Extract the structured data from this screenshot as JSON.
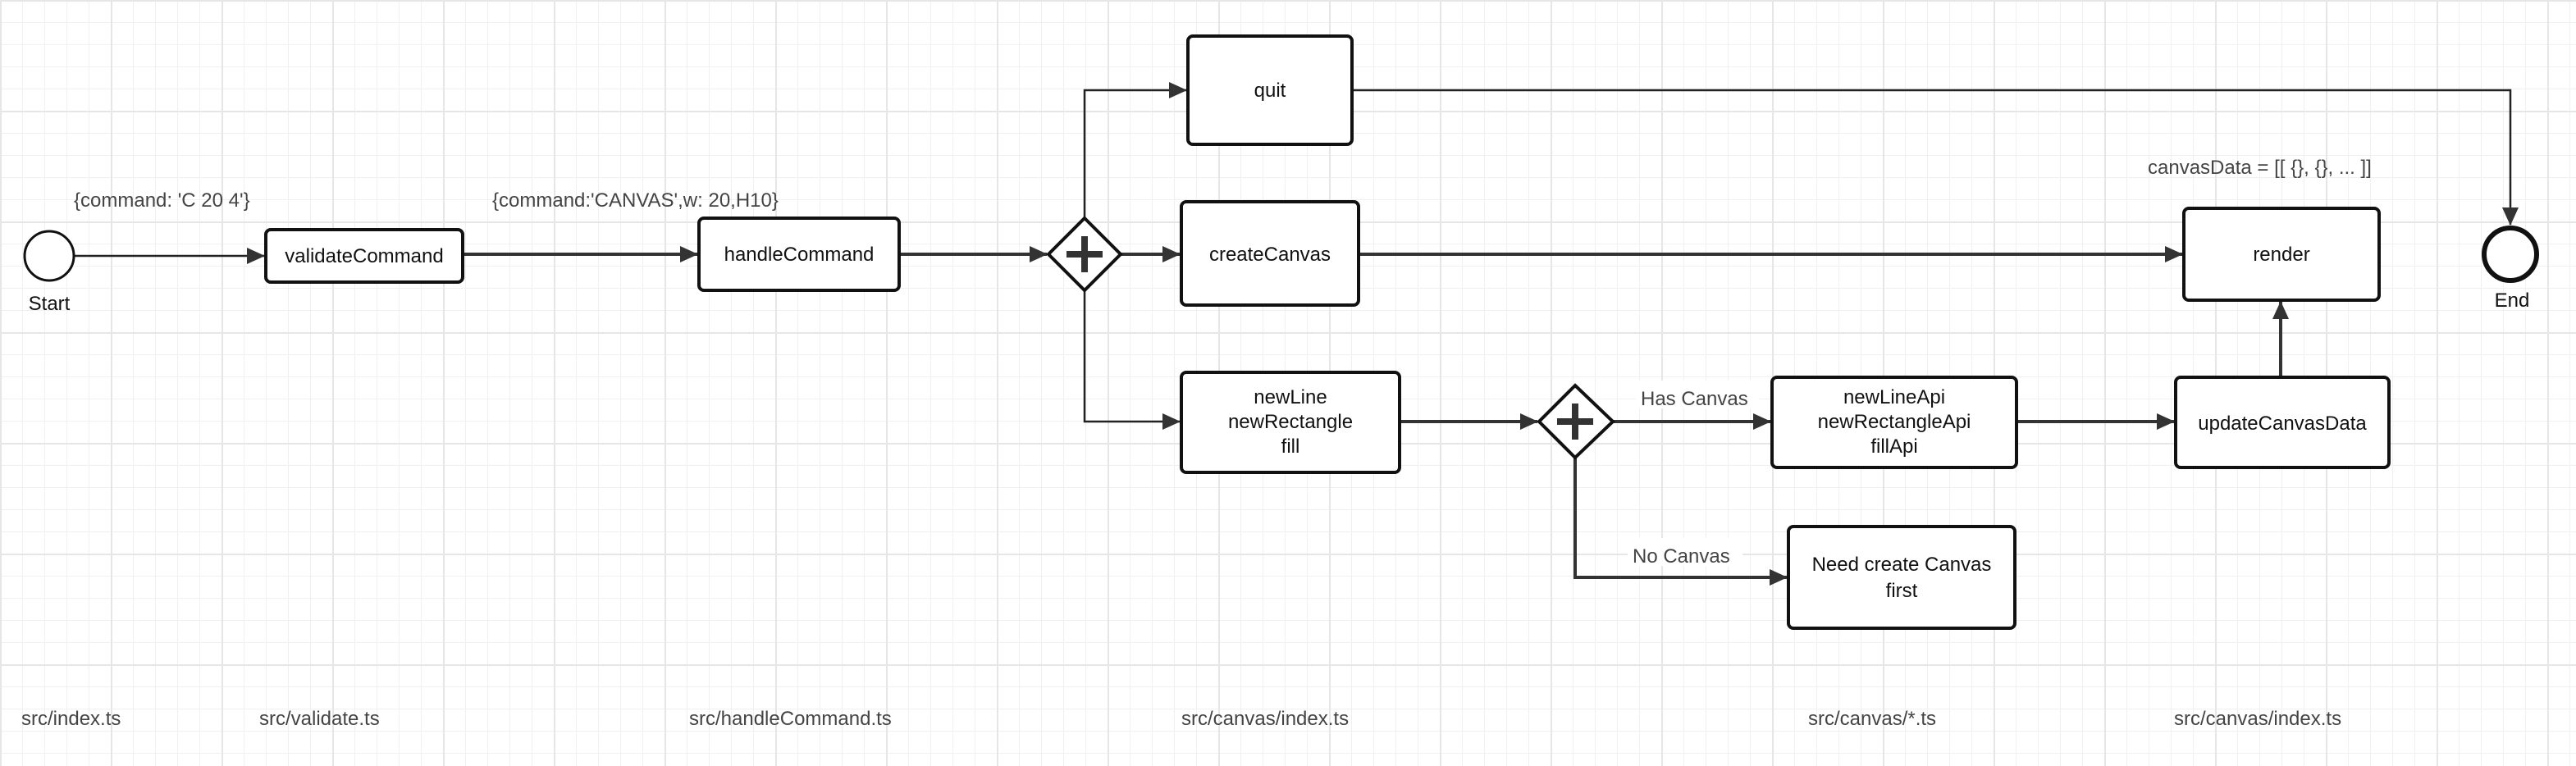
{
  "events": {
    "start": "Start",
    "end": "End"
  },
  "annotations": {
    "input": "{command: 'C 20 4'}",
    "parsed": "{command:'CANVAS',w: 20,H10}",
    "canvas_data": "canvasData = [[ {}, {}, ... ]]",
    "has_canvas": "Has Canvas",
    "no_canvas": "No Canvas"
  },
  "tasks": {
    "validate": "validateCommand",
    "handle": "handleCommand",
    "quit": "quit",
    "create_canvas": "createCanvas",
    "draw_commands": [
      "newLine",
      "newRectangle",
      "fill"
    ],
    "draw_apis": [
      "newLineApi",
      "newRectangleApi",
      "fillApi"
    ],
    "update": "updateCanvasData",
    "render": "render",
    "need_canvas": [
      "Need create Canvas",
      "first"
    ]
  },
  "files": [
    "src/index.ts",
    "src/validate.ts",
    "src/handleCommand.ts",
    "src/canvas/index.ts",
    "src/canvas/*.ts",
    "src/canvas/index.ts"
  ]
}
